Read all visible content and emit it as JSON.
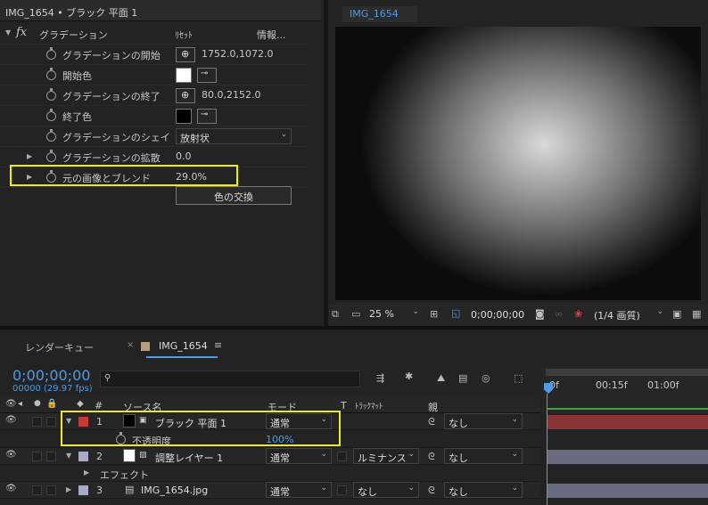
{
  "effect_controls": {
    "header": "IMG_1654 • ブラック 平面 1",
    "effect": {
      "fx": "fx",
      "name": "グラデーション",
      "reset": "ﾘｾｯﾄ",
      "info": "情報..."
    },
    "props": [
      {
        "label": "グラデーションの開始",
        "value": "1752.0,1072.0"
      },
      {
        "label": "開始色",
        "color": "#ffffff"
      },
      {
        "label": "グラデーションの終了",
        "value": "80.0,2152.0"
      },
      {
        "label": "終了色",
        "color": "#000000"
      },
      {
        "label": "グラデーションのシェイ",
        "value": "放射状"
      },
      {
        "label": "グラデーションの拡散",
        "value": "0.0"
      },
      {
        "label": "元の画像とブレンド",
        "value": "29.0%"
      }
    ],
    "swap_button": "色の交換"
  },
  "viewer": {
    "tab": "IMG_1654",
    "zoom": "25 %",
    "timecode": "0;00;00;00",
    "resolution": "(1/4 画質)"
  },
  "panel_tabs": {
    "render_queue": "レンダーキュー",
    "comp": "IMG_1654",
    "menu_icon": "≡"
  },
  "timeline": {
    "timecode": "0;00;00;00",
    "frames": "00000 (29.97 fps)",
    "search_placeholder": "",
    "cols": {
      "num": "#",
      "source": "ソース名",
      "mode": "モード",
      "t": "T",
      "trackmatte": "ﾄﾗｯｸﾏｯﾄ",
      "parent": "親"
    },
    "ruler": [
      "0f",
      "00:15f",
      "01:00f"
    ],
    "layers": [
      {
        "num": "1",
        "name": "ブラック 平面 1",
        "label_color": "#c23b3b",
        "mode": "通常",
        "trackmatte": "",
        "parent": "なし"
      },
      {
        "num": "2",
        "name": "調整レイヤー 1",
        "label_color": "#a9a9c9",
        "mode": "通常",
        "trackmatte": "ルミナンス",
        "parent": "なし"
      },
      {
        "num": "3",
        "name": "IMG_1654.jpg",
        "label_color": "#a9a9c9",
        "mode": "通常",
        "trackmatte": "なし",
        "parent": "なし"
      }
    ],
    "opacity": {
      "label": "不透明度",
      "value": "100%"
    },
    "effect_group": "エフェクト"
  },
  "colors": {
    "accent": "#4c9ce6",
    "highlight": "#f1ee00",
    "layer1_bar": "#8a3535",
    "layer_bar": "#6a6a80"
  }
}
